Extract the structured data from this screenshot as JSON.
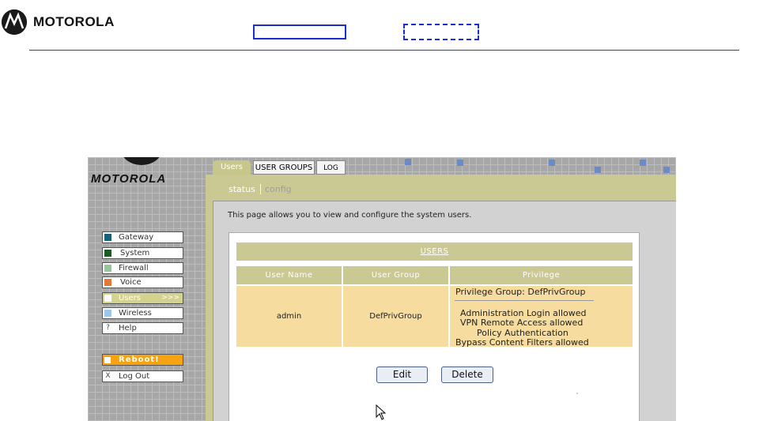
{
  "header": {
    "brand": "MOTOROLA"
  },
  "app": {
    "brand": "MOTOROLA",
    "tabs": [
      {
        "label": "Users"
      },
      {
        "label": "USER GROUPS"
      },
      {
        "label": "LOG"
      }
    ],
    "subtabs": {
      "status": "status",
      "config": "config"
    },
    "nav": {
      "gateway": "Gateway",
      "system": "System",
      "firewall": "Firewall",
      "voice": "Voice",
      "users": "Users",
      "users_arrows": ">>>",
      "wireless": "Wireless",
      "help": "Help",
      "help_glyph": "?",
      "reboot": "Reboot!",
      "logout": "Log Out",
      "logout_glyph": "X"
    },
    "description": "This page allows you to view and configure the system users.",
    "users_table": {
      "title": "USERS",
      "columns": [
        "User Name",
        "User Group",
        "Privilege"
      ],
      "row": {
        "user_name": "admin",
        "user_group": "DefPrivGroup",
        "privilege_group": "Privilege Group: DefPrivGroup",
        "permissions": [
          "Administration Login allowed",
          "VPN Remote Access allowed",
          "Policy Authentication",
          "Bypass Content Filters allowed"
        ]
      }
    },
    "buttons": {
      "edit": "Edit",
      "delete": "Delete"
    }
  },
  "colors": {
    "nav_gateway": "#17607a",
    "nav_system": "#1d5a25",
    "nav_firewall": "#96c59b",
    "nav_voice": "#e07a35",
    "nav_users": "#ffffff",
    "nav_wireless": "#9cc6ec",
    "accent_olive": "#cac993",
    "row_fill": "#f6dc9f",
    "reboot": "#f5a311",
    "box_blue": "#1a2fd0"
  }
}
